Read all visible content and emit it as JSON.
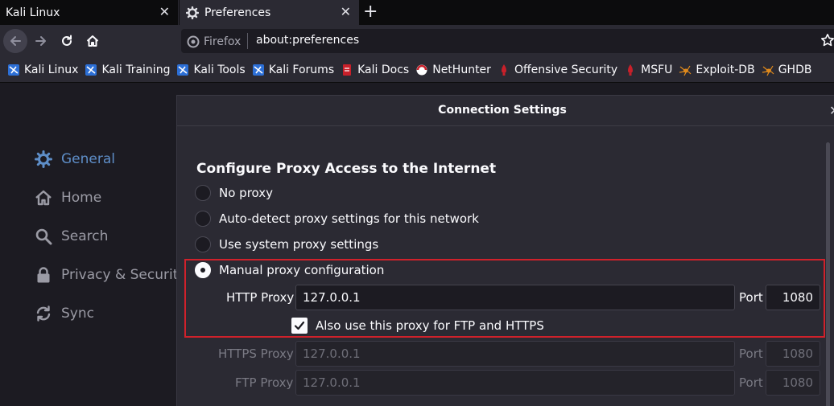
{
  "tabs": [
    {
      "label": "Kali Linux",
      "active": false
    },
    {
      "label": "Preferences",
      "active": true
    }
  ],
  "navbar": {
    "identity_label": "Firefox",
    "url": "about:preferences"
  },
  "bookmarks": [
    {
      "label": "Kali Linux",
      "icon": "kali-dragon-icon"
    },
    {
      "label": "Kali Training",
      "icon": "kali-dragon-icon"
    },
    {
      "label": "Kali Tools",
      "icon": "kali-dragon-icon"
    },
    {
      "label": "Kali Forums",
      "icon": "kali-dragon-icon"
    },
    {
      "label": "Kali Docs",
      "icon": "kali-docs-icon"
    },
    {
      "label": "NetHunter",
      "icon": "nethunter-icon"
    },
    {
      "label": "Offensive Security",
      "icon": "offsec-icon"
    },
    {
      "label": "MSFU",
      "icon": "offsec-icon"
    },
    {
      "label": "Exploit-DB",
      "icon": "spider-icon"
    },
    {
      "label": "GHDB",
      "icon": "spider-icon"
    }
  ],
  "sidebar": {
    "items": [
      {
        "label": "General",
        "icon": "gear-icon",
        "active": true
      },
      {
        "label": "Home",
        "icon": "home-icon",
        "active": false
      },
      {
        "label": "Search",
        "icon": "search-icon",
        "active": false
      },
      {
        "label": "Privacy & Security",
        "icon": "lock-icon",
        "active": false
      },
      {
        "label": "Sync",
        "icon": "sync-icon",
        "active": false
      }
    ]
  },
  "dialog": {
    "title": "Connection Settings",
    "section_title": "Configure Proxy Access to the Internet",
    "options": [
      {
        "label": "No proxy",
        "checked": false
      },
      {
        "label": "Auto-detect proxy settings for this network",
        "checked": false
      },
      {
        "label": "Use system proxy settings",
        "checked": false
      },
      {
        "label": "Manual proxy configuration",
        "checked": true
      }
    ],
    "http_proxy": {
      "label": "HTTP Proxy",
      "value": "127.0.0.1",
      "port_label": "Port",
      "port": "1080"
    },
    "also_use_label": "Also use this proxy for FTP and HTTPS",
    "also_use_checked": true,
    "https_proxy": {
      "label": "HTTPS Proxy",
      "value": "127.0.0.1",
      "port_label": "Port",
      "port": "1080"
    },
    "ftp_proxy": {
      "label": "FTP Proxy",
      "value": "127.0.0.1",
      "port_label": "Port",
      "port": "1080"
    }
  },
  "colors": {
    "accent": "#5e8ec8",
    "highlight_border": "#d0212b",
    "dialog_bg": "#2b2a33",
    "page_bg": "#1c1b22"
  }
}
